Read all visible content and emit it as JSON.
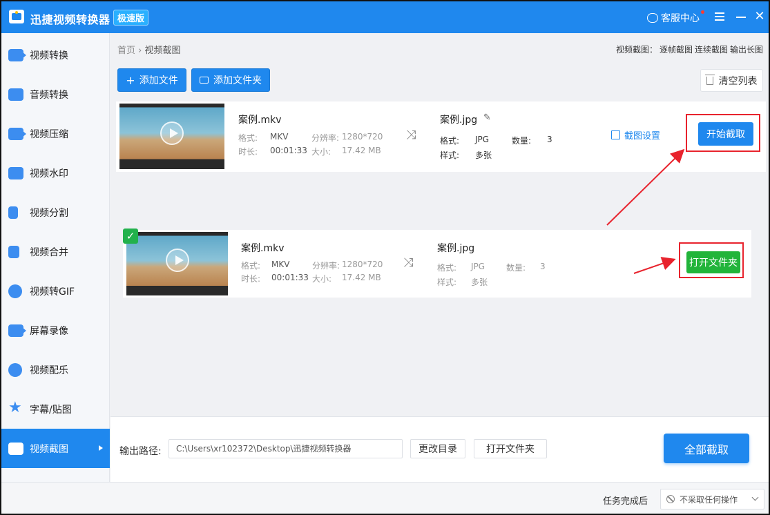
{
  "window": {
    "title": "迅捷视频转换器",
    "edition": "极速版",
    "service": "客服中心"
  },
  "sidebar": {
    "items": [
      {
        "label": "视频转换",
        "icon": "video-convert-icon"
      },
      {
        "label": "音频转换",
        "icon": "audio-convert-icon"
      },
      {
        "label": "视频压缩",
        "icon": "video-compress-icon"
      },
      {
        "label": "视频水印",
        "icon": "video-watermark-icon"
      },
      {
        "label": "视频分割",
        "icon": "video-split-icon"
      },
      {
        "label": "视频合并",
        "icon": "video-merge-icon"
      },
      {
        "label": "视频转GIF",
        "icon": "video-gif-icon"
      },
      {
        "label": "屏幕录像",
        "icon": "screen-record-icon"
      },
      {
        "label": "视频配乐",
        "icon": "video-music-icon"
      },
      {
        "label": "字幕/贴图",
        "icon": "subtitle-sticker-icon"
      },
      {
        "label": "视频截图",
        "icon": "video-screenshot-icon",
        "active": true
      }
    ]
  },
  "breadcrumb": {
    "home": "首页",
    "sep": "›",
    "current": "视频截图"
  },
  "modes": {
    "prefix": "视频截图：",
    "frame": "逐帧截图",
    "continuous": "连续截图",
    "long": "输出长图"
  },
  "toolbar": {
    "add_file": "添加文件",
    "add_folder": "添加文件夹",
    "clear": "清空列表"
  },
  "tasks": [
    {
      "source": {
        "name": "案例.mkv",
        "format_label": "格式:",
        "format": "MKV",
        "res_label": "分辨率:",
        "res": "1280*720",
        "dur_label": "时长:",
        "duration": "00:01:33",
        "size_label": "大小:",
        "size": "17.42 MB"
      },
      "output": {
        "name": "案例.jpg",
        "format_label": "格式:",
        "format": "JPG",
        "count_label": "数量:",
        "count": "3",
        "style_label": "样式:",
        "style": "多张"
      },
      "setting": "截图设置",
      "action": "开始截取"
    },
    {
      "source": {
        "name": "案例.mkv",
        "format_label": "格式:",
        "format": "MKV",
        "res_label": "分辨率:",
        "res": "1280*720",
        "dur_label": "时长:",
        "duration": "00:01:33",
        "size_label": "大小:",
        "size": "17.42 MB"
      },
      "output": {
        "name": "案例.jpg",
        "format_label": "格式:",
        "format": "JPG",
        "count_label": "数量:",
        "count": "3",
        "style_label": "样式:",
        "style": "多张"
      },
      "action": "打开文件夹",
      "done": true
    }
  ],
  "output": {
    "label": "输出路径:",
    "path": "C:\\Users\\xr102372\\Desktop\\迅捷视频转换器",
    "change_dir": "更改目录",
    "open_folder": "打开文件夹",
    "capture_all": "全部截取"
  },
  "status": {
    "after_done_label": "任务完成后",
    "after_done_value": "不采取任何操作"
  },
  "colors": {
    "primary": "#1f88ee",
    "success": "#22b43a",
    "annotation": "#e8232d"
  }
}
